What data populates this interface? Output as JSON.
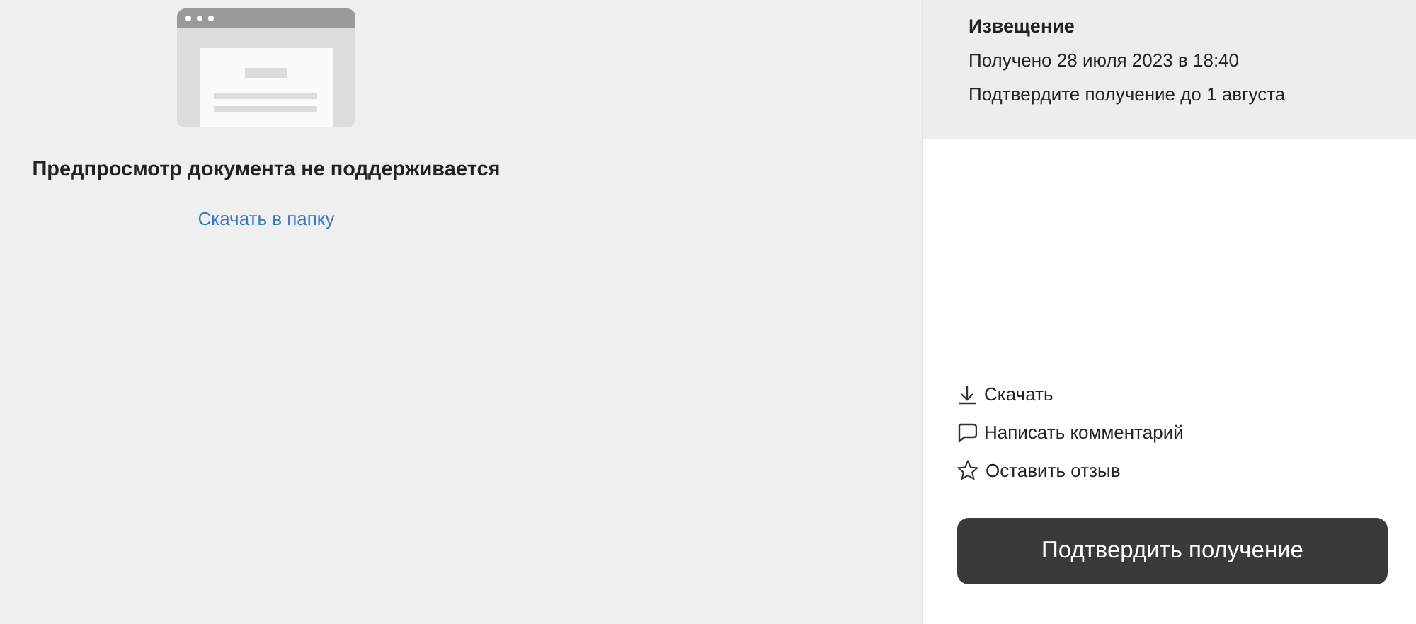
{
  "preview": {
    "message": "Предпросмотр документа не поддерживается",
    "link": "Скачать в папку"
  },
  "notice": {
    "title": "Извещение",
    "received": "Получено 28 июля 2023 в 18:40",
    "deadline": "Подтвердите получение до 1 августа"
  },
  "actions": [
    {
      "kind": "download",
      "label": "Скачать"
    },
    {
      "kind": "comment",
      "label": "Написать комментарий"
    },
    {
      "kind": "review",
      "label": "Оставить отзыв"
    }
  ],
  "confirm_button": "Подтвердить получение"
}
